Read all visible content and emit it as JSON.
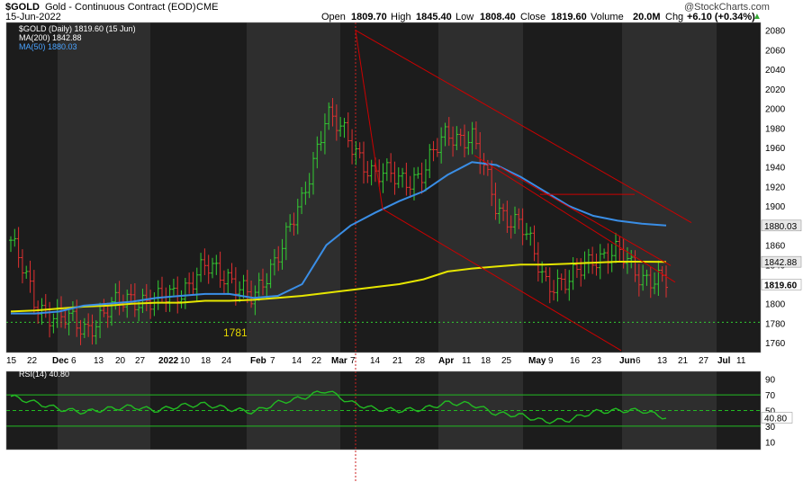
{
  "header": {
    "symbol": "$GOLD",
    "name": "Gold - Continuous Contract (EOD)",
    "exchange": "CME",
    "date": "15-Jun-2022",
    "watermark": "@StockCharts.com",
    "open_label": "Open",
    "open": "1809.70",
    "high_label": "High",
    "high": "1845.40",
    "low_label": "Low",
    "low": "1808.40",
    "close_label": "Close",
    "close": "1819.60",
    "volume_label": "Volume",
    "volume": "20.0M",
    "chg_label": "Chg",
    "chg": "+6.10 (+0.34%)"
  },
  "legend": {
    "price": "$GOLD (Daily) 1819.60 (15 Jun)",
    "ma200": "MA(200) 1842.88",
    "ma50": "MA(50) 1880.03"
  },
  "annotations": {
    "low_label": "1781"
  },
  "rsi_label": "RSI(14) 40.80",
  "colors": {
    "up": "#33cc33",
    "down": "#e03030",
    "ma200": "#e6e600",
    "ma50": "#3a8ee6",
    "channel": "#cc0000",
    "rsi_line": "#22bb22",
    "band_dark": "#1c1c1c",
    "band_light": "#2e2e2e"
  },
  "chart_data": [
    {
      "type": "line",
      "title": "$GOLD (Daily)",
      "x": [
        "Nov 15",
        "Nov 22",
        "Dec 6",
        "Dec 13",
        "Dec 20",
        "Dec 27",
        "Jan 3",
        "Jan 10",
        "Jan 18",
        "Jan 24",
        "Feb 7",
        "Feb 14",
        "Feb 22",
        "Mar 7",
        "Mar 14",
        "Mar 21",
        "Mar 28",
        "Apr 4",
        "Apr 11",
        "Apr 18",
        "Apr 25",
        "May 2",
        "May 9",
        "May 16",
        "May 23",
        "Jun 6",
        "Jun 13",
        "Jun 15"
      ],
      "series": [
        {
          "name": "$GOLD (Daily)",
          "values": [
            1865,
            1800,
            1785,
            1775,
            1792,
            1808,
            1800,
            1815,
            1835,
            1830,
            1800,
            1855,
            1900,
            2000,
            1960,
            1935,
            1925,
            1935,
            1975,
            1970,
            1900,
            1880,
            1825,
            1820,
            1850,
            1850,
            1830,
            1819.6
          ]
        },
        {
          "name": "MA(200)",
          "values": [
            1792,
            1793,
            1795,
            1797,
            1798,
            1800,
            1801,
            1801,
            1803,
            1803,
            1804,
            1806,
            1808,
            1811,
            1814,
            1817,
            1820,
            1825,
            1833,
            1836,
            1838,
            1840,
            1840,
            1841,
            1842,
            1843,
            1843,
            1842.88
          ]
        },
        {
          "name": "MA(50)",
          "values": [
            1790,
            1790,
            1792,
            1798,
            1800,
            1802,
            1806,
            1808,
            1810,
            1810,
            1806,
            1808,
            1820,
            1860,
            1880,
            1893,
            1905,
            1915,
            1932,
            1945,
            1942,
            1930,
            1915,
            1900,
            1890,
            1885,
            1882,
            1880.03
          ]
        }
      ],
      "xticks": [
        "15",
        "22",
        "Dec",
        "6",
        "13",
        "20",
        "27",
        "2022",
        "10",
        "18",
        "24",
        "Feb",
        "7",
        "14",
        "22",
        "Mar",
        "7",
        "14",
        "21",
        "28",
        "Apr",
        "11",
        "18",
        "25",
        "May",
        "9",
        "16",
        "23",
        "Jun",
        "6",
        "13",
        "21",
        "27",
        "Jul",
        "11"
      ],
      "yticks": [
        1760,
        1780,
        1800,
        1820,
        1840,
        1860,
        1880,
        1900,
        1920,
        1940,
        1960,
        1980,
        2000,
        2020,
        2040,
        2060,
        2080
      ],
      "ylim": [
        1750,
        2088
      ],
      "price_labels": [
        "1880.03",
        "1842.88",
        "1819.60"
      ],
      "horizontal_line": 1781,
      "grid": false
    },
    {
      "type": "line",
      "title": "RSI(14)",
      "series": [
        {
          "name": "RSI(14)",
          "values": [
            68,
            60,
            52,
            48,
            52,
            55,
            50,
            56,
            58,
            52,
            48,
            60,
            66,
            76,
            60,
            52,
            50,
            52,
            60,
            58,
            46,
            44,
            36,
            38,
            48,
            50,
            50,
            40.8
          ]
        }
      ],
      "yticks": [
        10,
        30,
        50,
        70,
        90
      ],
      "ylim": [
        0,
        100
      ],
      "reference_lines": [
        30,
        50,
        70
      ],
      "current_label": "40.80"
    }
  ]
}
